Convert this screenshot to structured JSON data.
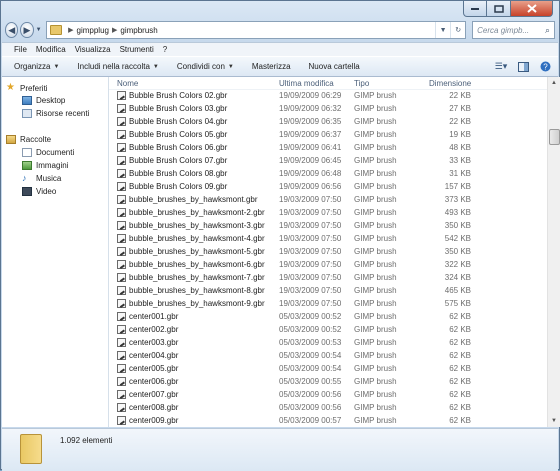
{
  "address": {
    "crumbs": [
      "gimpplug",
      "gimpbrush"
    ],
    "search_placeholder": "Cerca gimpb..."
  },
  "menu": [
    "File",
    "Modifica",
    "Visualizza",
    "Strumenti",
    "?"
  ],
  "toolbar": {
    "organize": "Organizza",
    "include": "Includi nella raccolta",
    "share": "Condividi con",
    "burn": "Masterizza",
    "new_folder": "Nuova cartella"
  },
  "nav": {
    "favorites": "Preferiti",
    "desktop": "Desktop",
    "recent": "Risorse recenti",
    "libraries": "Raccolte",
    "documents": "Documenti",
    "images": "Immagini",
    "music": "Musica",
    "video": "Video"
  },
  "columns": {
    "name": "Nome",
    "modified": "Ultima modifica",
    "type": "Tipo",
    "size": "Dimensione"
  },
  "files": [
    {
      "name": "Bubble Brush Colors 02.gbr",
      "date": "19/09/2009 06:29",
      "type": "GIMP brush",
      "size": "22 KB"
    },
    {
      "name": "Bubble Brush Colors 03.gbr",
      "date": "19/09/2009 06:32",
      "type": "GIMP brush",
      "size": "27 KB"
    },
    {
      "name": "Bubble Brush Colors 04.gbr",
      "date": "19/09/2009 06:35",
      "type": "GIMP brush",
      "size": "22 KB"
    },
    {
      "name": "Bubble Brush Colors 05.gbr",
      "date": "19/09/2009 06:37",
      "type": "GIMP brush",
      "size": "19 KB"
    },
    {
      "name": "Bubble Brush Colors 06.gbr",
      "date": "19/09/2009 06:41",
      "type": "GIMP brush",
      "size": "48 KB"
    },
    {
      "name": "Bubble Brush Colors 07.gbr",
      "date": "19/09/2009 06:45",
      "type": "GIMP brush",
      "size": "33 KB"
    },
    {
      "name": "Bubble Brush Colors 08.gbr",
      "date": "19/09/2009 06:48",
      "type": "GIMP brush",
      "size": "31 KB"
    },
    {
      "name": "Bubble Brush Colors 09.gbr",
      "date": "19/09/2009 06:56",
      "type": "GIMP brush",
      "size": "157 KB"
    },
    {
      "name": "bubble_brushes_by_hawksmont.gbr",
      "date": "19/03/2009 07:50",
      "type": "GIMP brush",
      "size": "373 KB"
    },
    {
      "name": "bubble_brushes_by_hawksmont-2.gbr",
      "date": "19/03/2009 07:50",
      "type": "GIMP brush",
      "size": "493 KB"
    },
    {
      "name": "bubble_brushes_by_hawksmont-3.gbr",
      "date": "19/03/2009 07:50",
      "type": "GIMP brush",
      "size": "350 KB"
    },
    {
      "name": "bubble_brushes_by_hawksmont-4.gbr",
      "date": "19/03/2009 07:50",
      "type": "GIMP brush",
      "size": "542 KB"
    },
    {
      "name": "bubble_brushes_by_hawksmont-5.gbr",
      "date": "19/03/2009 07:50",
      "type": "GIMP brush",
      "size": "350 KB"
    },
    {
      "name": "bubble_brushes_by_hawksmont-6.gbr",
      "date": "19/03/2009 07:50",
      "type": "GIMP brush",
      "size": "322 KB"
    },
    {
      "name": "bubble_brushes_by_hawksmont-7.gbr",
      "date": "19/03/2009 07:50",
      "type": "GIMP brush",
      "size": "324 KB"
    },
    {
      "name": "bubble_brushes_by_hawksmont-8.gbr",
      "date": "19/03/2009 07:50",
      "type": "GIMP brush",
      "size": "465 KB"
    },
    {
      "name": "bubble_brushes_by_hawksmont-9.gbr",
      "date": "19/03/2009 07:50",
      "type": "GIMP brush",
      "size": "575 KB"
    },
    {
      "name": "center001.gbr",
      "date": "05/03/2009 00:52",
      "type": "GIMP brush",
      "size": "62 KB"
    },
    {
      "name": "center002.gbr",
      "date": "05/03/2009 00:52",
      "type": "GIMP brush",
      "size": "62 KB"
    },
    {
      "name": "center003.gbr",
      "date": "05/03/2009 00:53",
      "type": "GIMP brush",
      "size": "62 KB"
    },
    {
      "name": "center004.gbr",
      "date": "05/03/2009 00:54",
      "type": "GIMP brush",
      "size": "62 KB"
    },
    {
      "name": "center005.gbr",
      "date": "05/03/2009 00:54",
      "type": "GIMP brush",
      "size": "62 KB"
    },
    {
      "name": "center006.gbr",
      "date": "05/03/2009 00:55",
      "type": "GIMP brush",
      "size": "62 KB"
    },
    {
      "name": "center007.gbr",
      "date": "05/03/2009 00:56",
      "type": "GIMP brush",
      "size": "62 KB"
    },
    {
      "name": "center008.gbr",
      "date": "05/03/2009 00:56",
      "type": "GIMP brush",
      "size": "62 KB"
    },
    {
      "name": "center009.gbr",
      "date": "05/03/2009 00:57",
      "type": "GIMP brush",
      "size": "62 KB"
    }
  ],
  "status": {
    "count": "1.092 elementi"
  }
}
